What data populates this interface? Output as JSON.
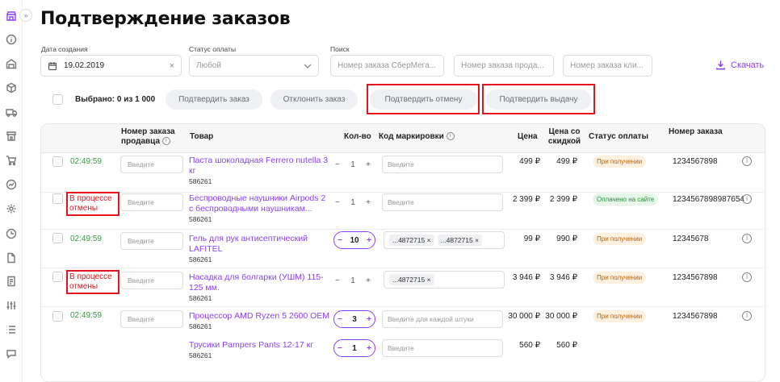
{
  "page_title": "Подтверждение заказов",
  "filters": {
    "date_label": "Дата создания",
    "date_value": "19.02.2019",
    "payment_label": "Статус оплаты",
    "payment_value": "Любой",
    "search_label": "Поиск",
    "search1_placeholder": "Номер заказа СберМега...",
    "search2_placeholder": "Номер заказа прода...",
    "search3_placeholder": "Номер заказа кли..."
  },
  "download_label": "Скачать",
  "selection_text": "Выбрано: 0 из 1 000",
  "actions": {
    "confirm_order": "Подтвердить заказ",
    "reject_order": "Отклонить заказ",
    "confirm_cancel": "Подтвердить отмену",
    "confirm_issue": "Подтвердить выдачу"
  },
  "columns": {
    "seller_order": "Номер заказа продавца",
    "product": "Товар",
    "qty": "Кол-во",
    "marking": "Код маркировки",
    "price": "Цена",
    "discount_price": "Цена со скидкой",
    "payment_status": "Статус оплаты",
    "order_no": "Номер заказа"
  },
  "input_placeholder": "Введите",
  "multi_input_placeholder": "Введите для каждой штуки",
  "info_glyph": "i",
  "rows": [
    {
      "status": "02:49:59",
      "product": "Паста шоколадная Ferrero nutella 3 кг",
      "sku": "586261",
      "qty": "1",
      "price": "499 ₽",
      "discount": "499 ₽",
      "payment": "При получении",
      "order": "1234567898"
    },
    {
      "status": "В процессе отмены",
      "product": "Беспроводные наушники Airpods 2 с беспроводными наушникам...",
      "sku": "586261",
      "qty": "1",
      "price": "2 399 ₽",
      "discount": "2 399 ₽",
      "payment": "Оплачено на сайте",
      "order": "1234567898987654"
    },
    {
      "status": "02:49:59",
      "product": "Гель для рук антисептический LAFITEL",
      "sku": "586261",
      "qty": "10",
      "chips": [
        "...4872715",
        "...4872715"
      ],
      "price": "99 ₽",
      "discount": "990 ₽",
      "payment": "При получении",
      "order": "12345678"
    },
    {
      "status": "В процессе отмены",
      "product": "Насадка для болгарки (УШМ) 115-125 мм.",
      "sku": "586261",
      "qty": "1",
      "chips": [
        "...4872715"
      ],
      "price": "3 946 ₽",
      "discount": "3 946 ₽",
      "payment": "При получении",
      "order": "1234567898"
    },
    {
      "status": "02:49:59",
      "product": "Процессор AMD Ryzen 5 2600 OEM",
      "sku": "586261",
      "qty": "3",
      "price": "30 000 ₽",
      "discount": "30 000 ₽",
      "payment": "При получении",
      "order": "1234567898"
    },
    {
      "status": "",
      "product": "Трусики Pampers Pants 12-17 кг",
      "sku": "586261",
      "qty": "1",
      "price": "560 ₽",
      "discount": "560 ₽",
      "payment": "",
      "order": ""
    }
  ]
}
